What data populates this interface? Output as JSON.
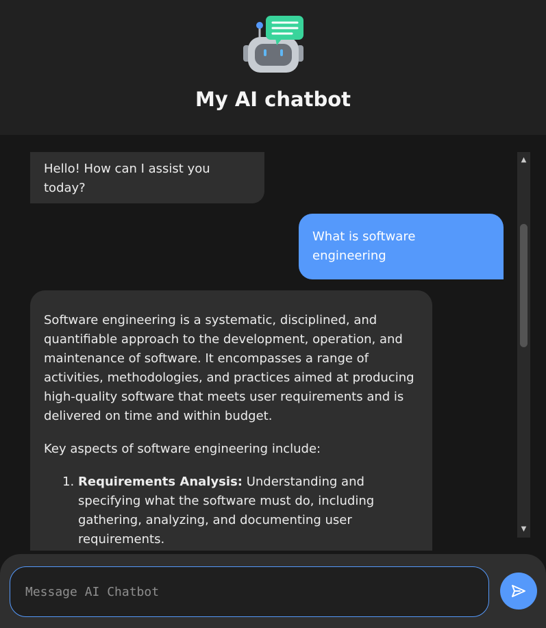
{
  "header": {
    "title": "My AI chatbot",
    "logo_icon": "robot-chat-icon"
  },
  "messages": [
    {
      "role": "bot",
      "text": "Hello! How can I assist you today?"
    },
    {
      "role": "user",
      "text": "What is software engineering"
    },
    {
      "role": "bot",
      "paragraphs": [
        "Software engineering is a systematic, disciplined, and quantifiable approach to the development, operation, and maintenance of software. It encompasses a range of activities, methodologies, and practices aimed at producing high-quality software that meets user requirements and is delivered on time and within budget.",
        "Key aspects of software engineering include:"
      ],
      "list": [
        {
          "title": "Requirements Analysis:",
          "text": " Understanding and specifying what the software must do, including gathering, analyzing, and documenting user requirements."
        }
      ]
    }
  ],
  "composer": {
    "placeholder": "Message AI Chatbot",
    "value": "",
    "send_icon": "send-icon"
  },
  "colors": {
    "accent": "#5599fb",
    "bot_bubble": "#2f2f2f",
    "background": "#171717",
    "header": "#212121"
  }
}
